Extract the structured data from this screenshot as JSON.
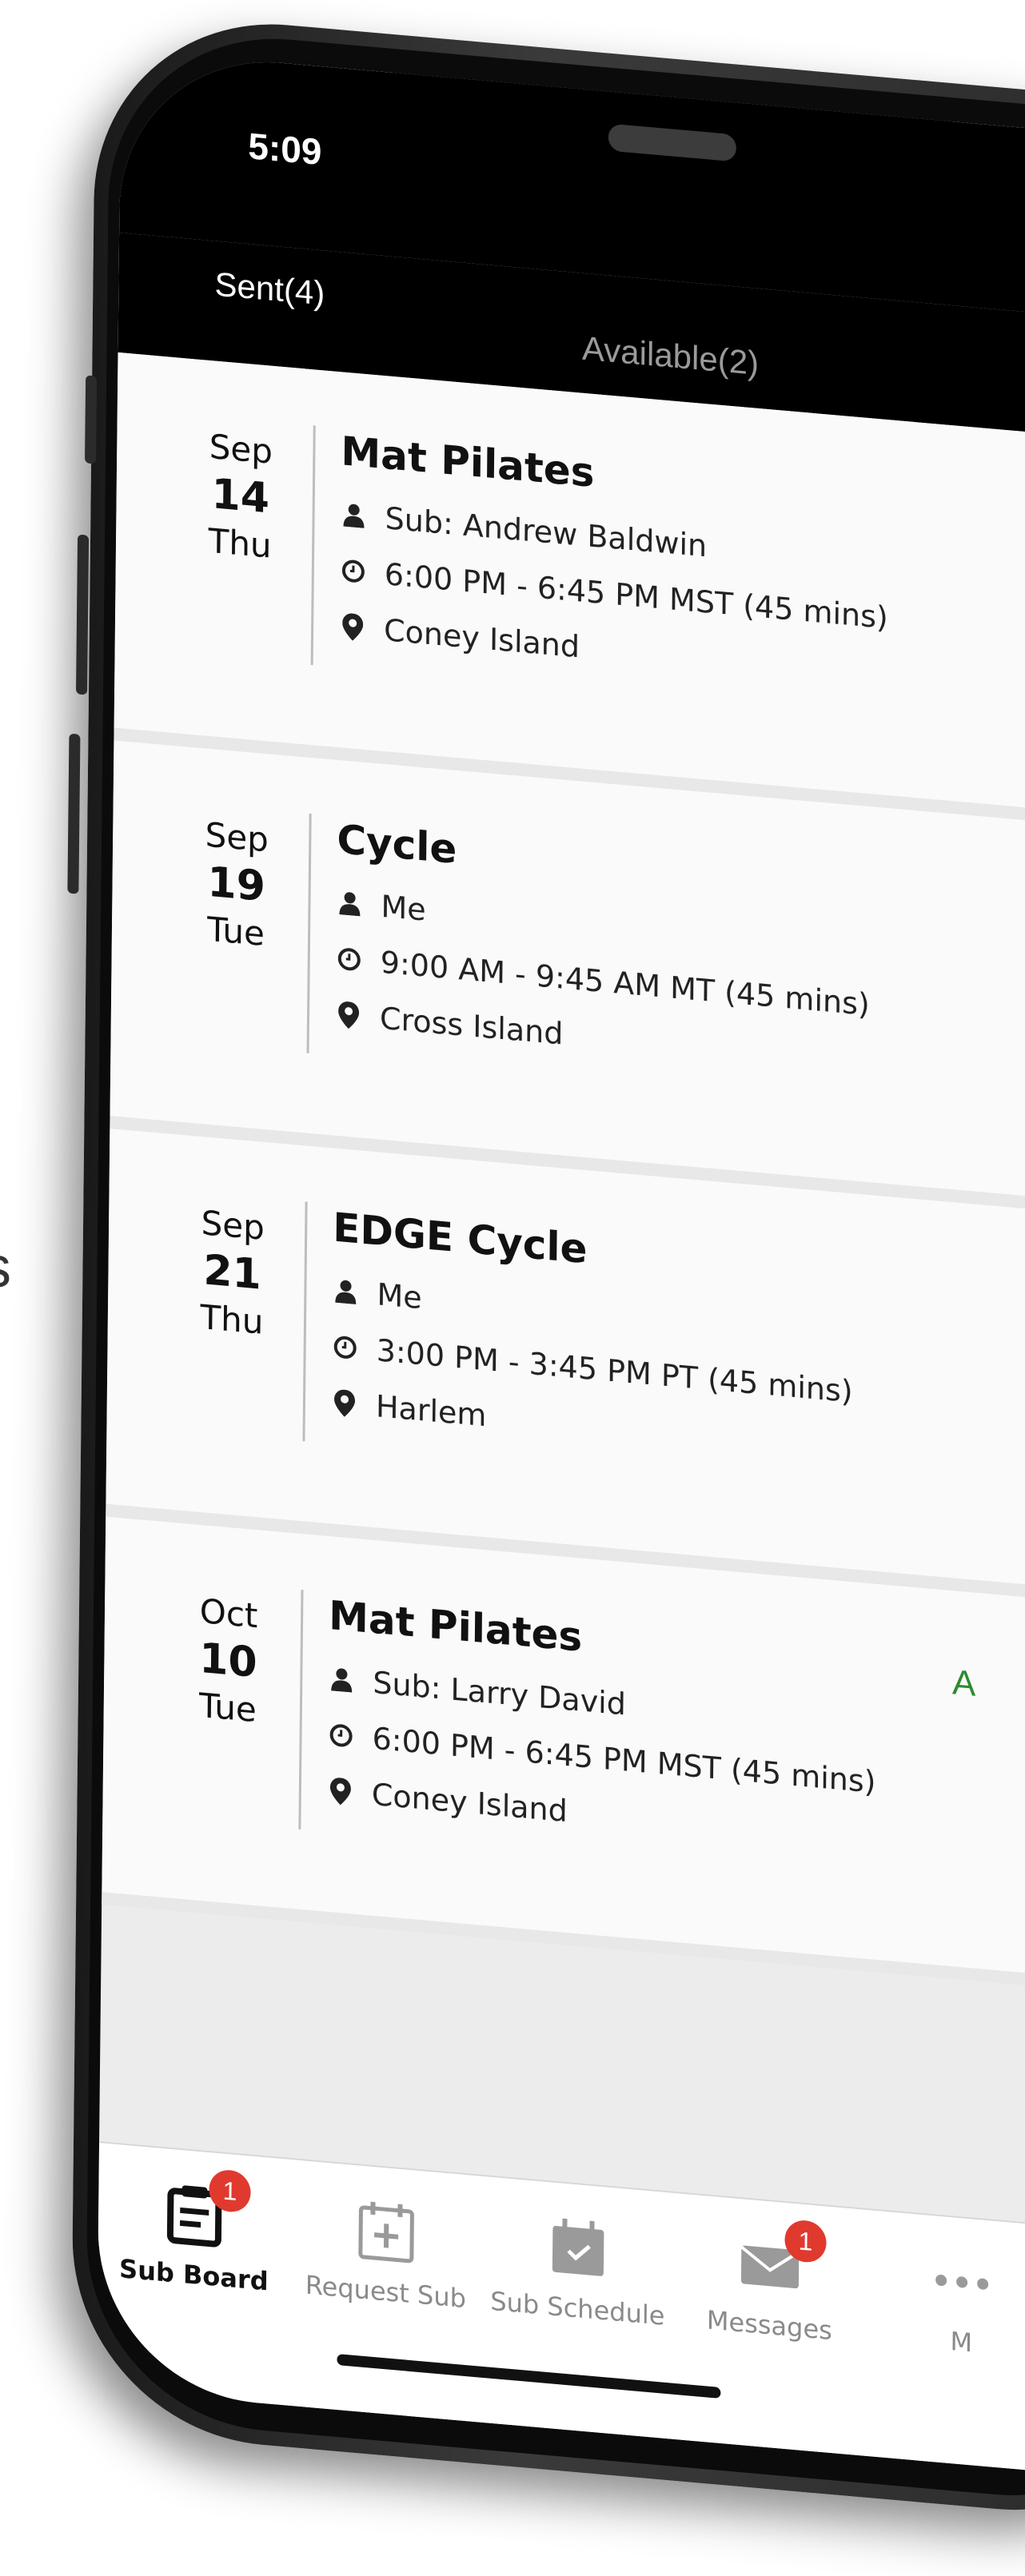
{
  "status": {
    "time": "5:09"
  },
  "tabs": [
    {
      "label": "Sent(4)",
      "active": true
    },
    {
      "label": "Available(2)",
      "active": false
    }
  ],
  "cards": [
    {
      "month": "Sep",
      "day": "14",
      "weekday": "Thu",
      "title": "Mat Pilates",
      "person": "Sub: Andrew Baldwin",
      "time": "6:00 PM -  6:45 PM MST (45 mins)",
      "location": "Coney Island",
      "status": ""
    },
    {
      "month": "Sep",
      "day": "19",
      "weekday": "Tue",
      "title": "Cycle",
      "person": "Me",
      "time": "9:00 AM -  9:45 AM MT (45 mins)",
      "location": "Cross Island",
      "status": ""
    },
    {
      "month": "Sep",
      "day": "21",
      "weekday": "Thu",
      "title": "EDGE Cycle",
      "person": "Me",
      "time": "3:00 PM -  3:45 PM PT (45 mins)",
      "location": "Harlem",
      "status": ""
    },
    {
      "month": "Oct",
      "day": "10",
      "weekday": "Tue",
      "title": "Mat Pilates",
      "person": "Sub: Larry David",
      "time": "6:00 PM -  6:45 PM MST (45 mins)",
      "location": "Coney Island",
      "status": "A"
    }
  ],
  "nav": [
    {
      "label": "Sub Board",
      "icon": "clipboard-icon",
      "badge": "1",
      "active": true
    },
    {
      "label": "Request Sub",
      "icon": "calendar-plus-icon",
      "badge": "",
      "active": false
    },
    {
      "label": "Sub Schedule",
      "icon": "calendar-check-icon",
      "badge": "",
      "active": false
    },
    {
      "label": "Messages",
      "icon": "envelope-icon",
      "badge": "1",
      "active": false
    },
    {
      "label": "M",
      "icon": "more-icon",
      "badge": "",
      "active": false
    }
  ],
  "page_edge_text": "s",
  "colors": {
    "accent_green": "#2e8b2e",
    "badge_red": "#e03a2f"
  }
}
